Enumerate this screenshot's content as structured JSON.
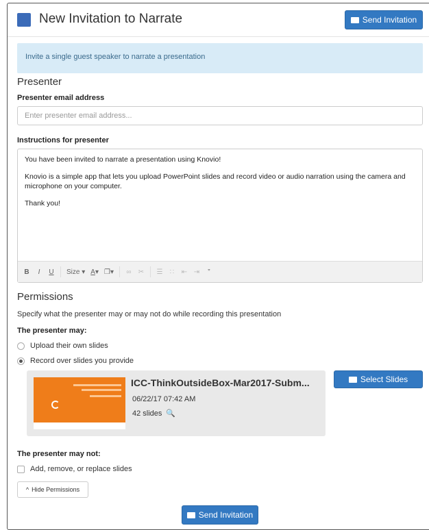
{
  "header": {
    "title": "New Invitation to Narrate",
    "send_label": "Send Invitation",
    "brand_color": "#3379c2"
  },
  "alert": {
    "text": "Invite a single guest speaker to narrate a presentation"
  },
  "presenter": {
    "heading": "Presenter",
    "email_label": "Presenter email address",
    "email_placeholder": "Enter presenter email address...",
    "email_value": "",
    "instructions_label": "Instructions for presenter",
    "instructions": [
      "You have been invited to narrate a presentation using Knovio!",
      "Knovio is a simple app that lets you upload PowerPoint slides and record video or audio narration using the camera and microphone on your computer.",
      "Thank you!"
    ]
  },
  "toolbar": {
    "bold": "B",
    "italic": "I",
    "underline": "U",
    "size": "Size",
    "font_color": "A",
    "bg_color": "❐",
    "link": "∞",
    "unlink": "✂",
    "ordered_list": "☰",
    "bullet_list": "∷",
    "outdent": "⇤",
    "indent": "⇥",
    "quote": "”"
  },
  "permissions": {
    "heading": "Permissions",
    "description": "Specify what the presenter may or may not do while recording this presentation",
    "may_label": "The presenter may:",
    "options": [
      "Upload their own slides",
      "Record over slides you provide"
    ],
    "selected_index": 1,
    "may_not_label": "The presenter may not:",
    "may_not_options": [
      "Add, remove, or replace slides"
    ],
    "hide_label": "Hide Permissions"
  },
  "presentation": {
    "title": "ICC-ThinkOutsideBox-Mar2017-Subm...",
    "date": "06/22/17 07:42 AM",
    "slides": "42 slides",
    "select_label": "Select Slides",
    "thumb_color": "#ef7d1a"
  },
  "footer": {
    "send_label": "Send Invitation"
  }
}
